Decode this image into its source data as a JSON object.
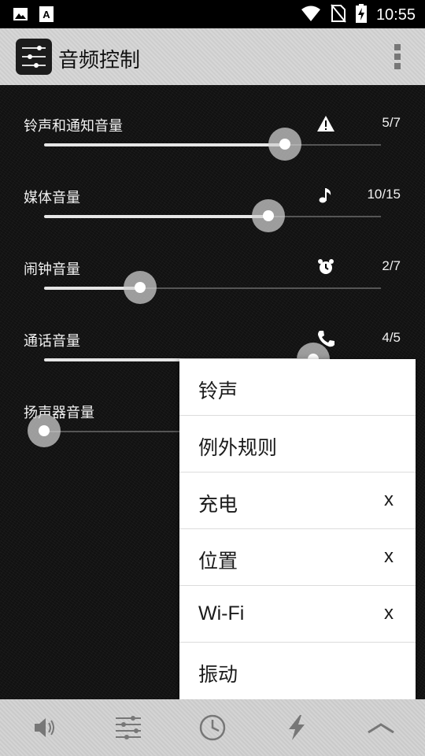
{
  "status_bar": {
    "time": "10:55",
    "left_icons": [
      "image-icon",
      "font-a-icon"
    ],
    "right_icons": [
      "wifi-icon",
      "no-sim-icon",
      "battery-charging-icon"
    ]
  },
  "app_bar": {
    "title": "音频控制",
    "overflow_icon": "more-vert-icon"
  },
  "volumes": [
    {
      "label": "铃声和通知音量",
      "icon": "warning-icon",
      "value_text": "5/7",
      "level": 0.714
    },
    {
      "label": "媒体音量",
      "icon": "music-note-icon",
      "value_text": "10/15",
      "level": 0.667
    },
    {
      "label": "闹钟音量",
      "icon": "alarm-clock-icon",
      "value_text": "2/7",
      "level": 0.286
    },
    {
      "label": "通话音量",
      "icon": "phone-icon",
      "value_text": "4/5",
      "level": 0.8
    },
    {
      "label": "扬声器音量",
      "icon": "",
      "value_text": "",
      "level": 0.0
    }
  ],
  "menu": {
    "items": [
      {
        "label": "铃声",
        "mark": ""
      },
      {
        "label": "例外规则",
        "mark": ""
      },
      {
        "label": "充电",
        "mark": "x"
      },
      {
        "label": "位置",
        "mark": "x"
      },
      {
        "label": "Wi-Fi",
        "mark": "x"
      },
      {
        "label": "振动",
        "mark": ""
      }
    ]
  },
  "bottom_bar": {
    "buttons": [
      "speaker-icon",
      "sliders-icon",
      "clock-icon",
      "lightning-icon",
      "chevron-up-icon"
    ]
  },
  "colors": {
    "background": "#111111",
    "slider_fill": "#e6e6e6",
    "slider_thumb": "#d2d2d2",
    "menu_bg": "#ffffff",
    "bar_bg": "#d2d2d2"
  }
}
